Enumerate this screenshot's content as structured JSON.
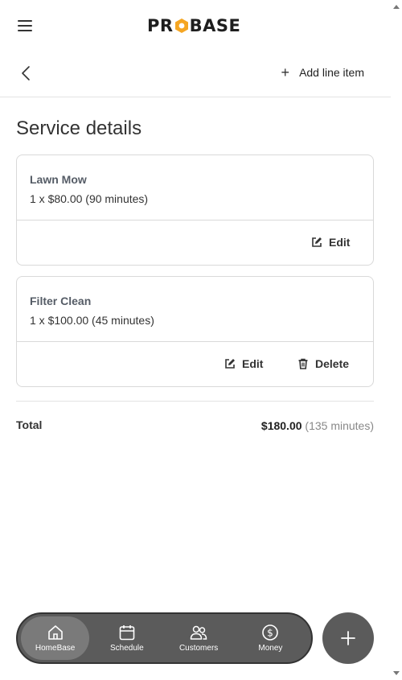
{
  "header": {
    "logo_text_left": "PR",
    "logo_text_right": "BASE",
    "add_line_item_label": "Add line item"
  },
  "page": {
    "title": "Service details"
  },
  "services": [
    {
      "name": "Lawn Mow",
      "detail": "1 x $80.00 (90 minutes)",
      "edit_label": "Edit"
    },
    {
      "name": "Filter Clean",
      "detail": "1 x $100.00 (45 minutes)",
      "edit_label": "Edit",
      "delete_label": "Delete"
    }
  ],
  "total": {
    "label": "Total",
    "amount": "$180.00",
    "minutes": "(135 minutes)"
  },
  "nav": {
    "items": [
      {
        "label": "HomeBase",
        "icon": "home-icon",
        "active": true
      },
      {
        "label": "Schedule",
        "icon": "calendar-icon"
      },
      {
        "label": "Customers",
        "icon": "users-icon"
      },
      {
        "label": "Money",
        "icon": "dollar-icon"
      }
    ]
  },
  "colors": {
    "logo_accent": "#f5a623",
    "nav_background": "#5b5b5b",
    "nav_active": "#7a7a7a"
  }
}
